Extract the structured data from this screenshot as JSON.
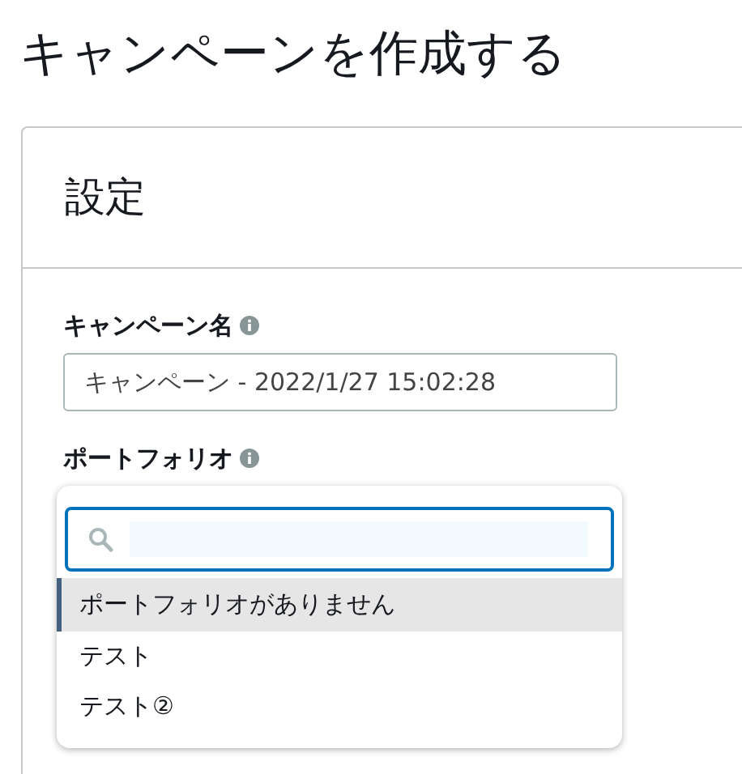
{
  "page_title": "キャンペーンを作成する",
  "card": {
    "title": "設定"
  },
  "campaign_name": {
    "label": "キャンペーン名",
    "value": "キャンペーン - 2022/1/27 15:02:28"
  },
  "portfolio": {
    "label": "ポートフォリオ",
    "options": [
      {
        "label": "ポートフォリオがありません",
        "selected": true
      },
      {
        "label": "テスト",
        "selected": false
      },
      {
        "label": "テスト②",
        "selected": false
      }
    ]
  }
}
